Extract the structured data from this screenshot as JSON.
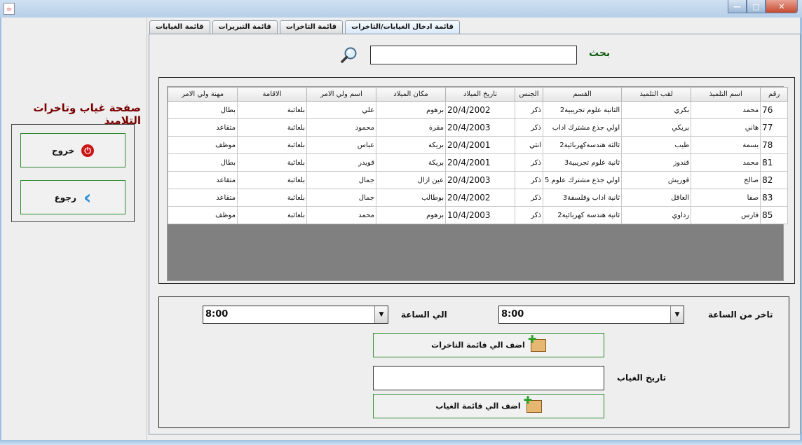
{
  "window": {
    "app_icon": "java-icon",
    "minimize": "—",
    "maximize": "□",
    "close": "✕"
  },
  "sidebar": {
    "title": "صفحة غياب وتاخرات التلاميذ",
    "exit_label": "خروج",
    "back_label": "رجوع"
  },
  "tabs": [
    {
      "label": "قائمة ادخال الغيابات/التاخرات",
      "active": true
    },
    {
      "label": "قائمة التاخرات",
      "active": false
    },
    {
      "label": "قائمة التبريرات",
      "active": false
    },
    {
      "label": "قائمة الغيابات",
      "active": false
    }
  ],
  "search": {
    "label": "بحث",
    "value": ""
  },
  "table": {
    "columns": [
      "رقم",
      "اسم التلميذ",
      "لقب التلميذ",
      "القسم",
      "الجنس",
      "تاريخ الميلاد",
      "مكان الميلاد",
      "اسم ولي الامر",
      "الاقامة",
      "مهنة ولي الامر"
    ],
    "rows": [
      [
        "76",
        "محمد",
        "بكري",
        "الثانية علوم تجريبية2",
        "ذكر",
        "20/4/2002",
        "برهوم",
        "علي",
        "بلعائبة",
        "بطال"
      ],
      [
        "77",
        "هاني",
        "بريكي",
        "اولي جذع مشترك اداب",
        "ذكر",
        "20/4/2003",
        "مقرة",
        "محمود",
        "بلعائبة",
        "متقاعد"
      ],
      [
        "78",
        "بسمة",
        "طيب",
        "ثالثة هندسةكهربائية2",
        "انثي",
        "20/4/2001",
        "بريكة",
        "عباس",
        "بلعائبة",
        "موظف"
      ],
      [
        "81",
        "محمد",
        "قندوز",
        "ثانية علوم تجريبية3",
        "ذكر",
        "20/4/2001",
        "بريكة",
        "قويدر",
        "بلعائبة",
        "بطال"
      ],
      [
        "82",
        "صالح",
        "قوريش",
        "اولي جذع مشترك علوم 5",
        "ذكر",
        "20/4/2003",
        "عين ازال",
        "جمال",
        "بلعائبة",
        "متقاعد"
      ],
      [
        "83",
        "صفا",
        "العاقل",
        "ثانية اداب وفلسفة3",
        "ذكر",
        "20/4/2002",
        "بوطالب",
        "جمال",
        "بلعائبة",
        "متقاعد"
      ],
      [
        "85",
        "فارس",
        "رداوي",
        "ثانية هندسة كهربائية2",
        "ذكر",
        "10/4/2003",
        "برهوم",
        "محمد",
        "بلعائبة",
        "موظف"
      ]
    ]
  },
  "form": {
    "late_from_label": "تاخر من الساعة",
    "late_from_value": "8:00",
    "to_label": "الي الساعة",
    "to_value": "8:00",
    "add_late_label": "اضف الي قائمة التاخرات",
    "absence_date_label": "تاريخ الغياب",
    "absence_date_value": "",
    "add_absence_label": "اضف الي قائمة الغياب"
  }
}
